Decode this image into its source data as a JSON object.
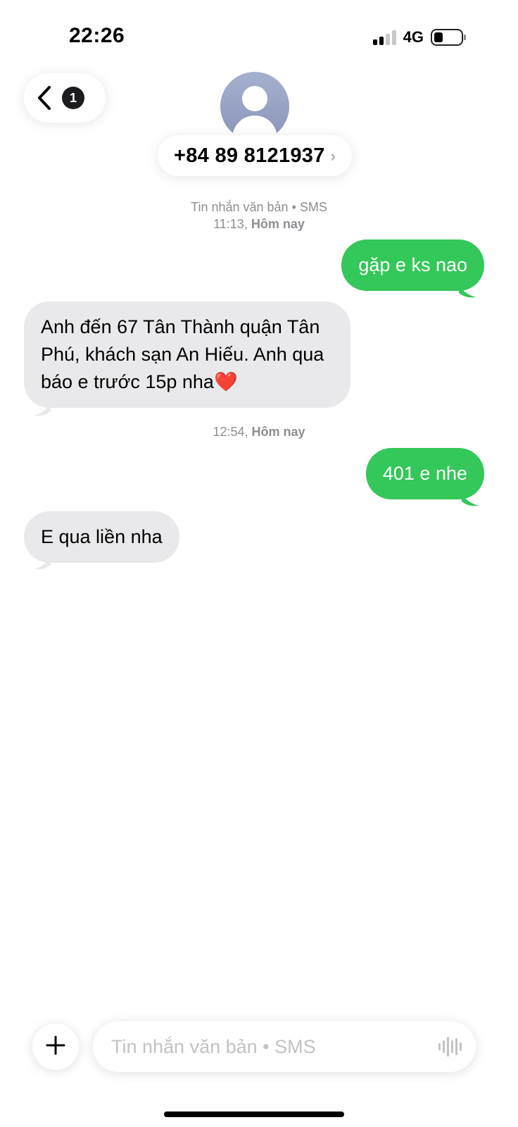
{
  "status_bar": {
    "time": "22:26",
    "network": "4G",
    "signal_bars_active": 2,
    "signal_bars_total": 4
  },
  "header": {
    "back_icon": "chevron-left-icon",
    "unread_count": "1",
    "avatar_icon": "person-silhouette-icon",
    "contact_name": "+84 89 8121937",
    "contact_chevron": "›"
  },
  "conversation": {
    "service_label": "Tin nhắn văn bản • SMS",
    "first_time": "11:13,",
    "first_day": "Hôm nay",
    "second_time": "12:54,",
    "second_day": "Hôm nay",
    "messages": [
      {
        "direction": "outgoing",
        "text": "gặp e ks nao"
      },
      {
        "direction": "incoming",
        "text": "Anh đến 67 Tân Thành quận Tân Phú, khách sạn An Hiếu. Anh qua báo e trước 15p nha❤️"
      },
      {
        "direction": "outgoing",
        "text": "401 e nhe"
      },
      {
        "direction": "incoming",
        "text": "E qua liền nha"
      }
    ]
  },
  "composer": {
    "placeholder": "Tin nhắn văn bản • SMS",
    "add_icon": "plus-icon",
    "audio_icon": "waveform-icon"
  },
  "colors": {
    "outgoing_bubble": "#34c759",
    "incoming_bubble": "#e9e9eb",
    "meta_text": "#8e8e93"
  }
}
